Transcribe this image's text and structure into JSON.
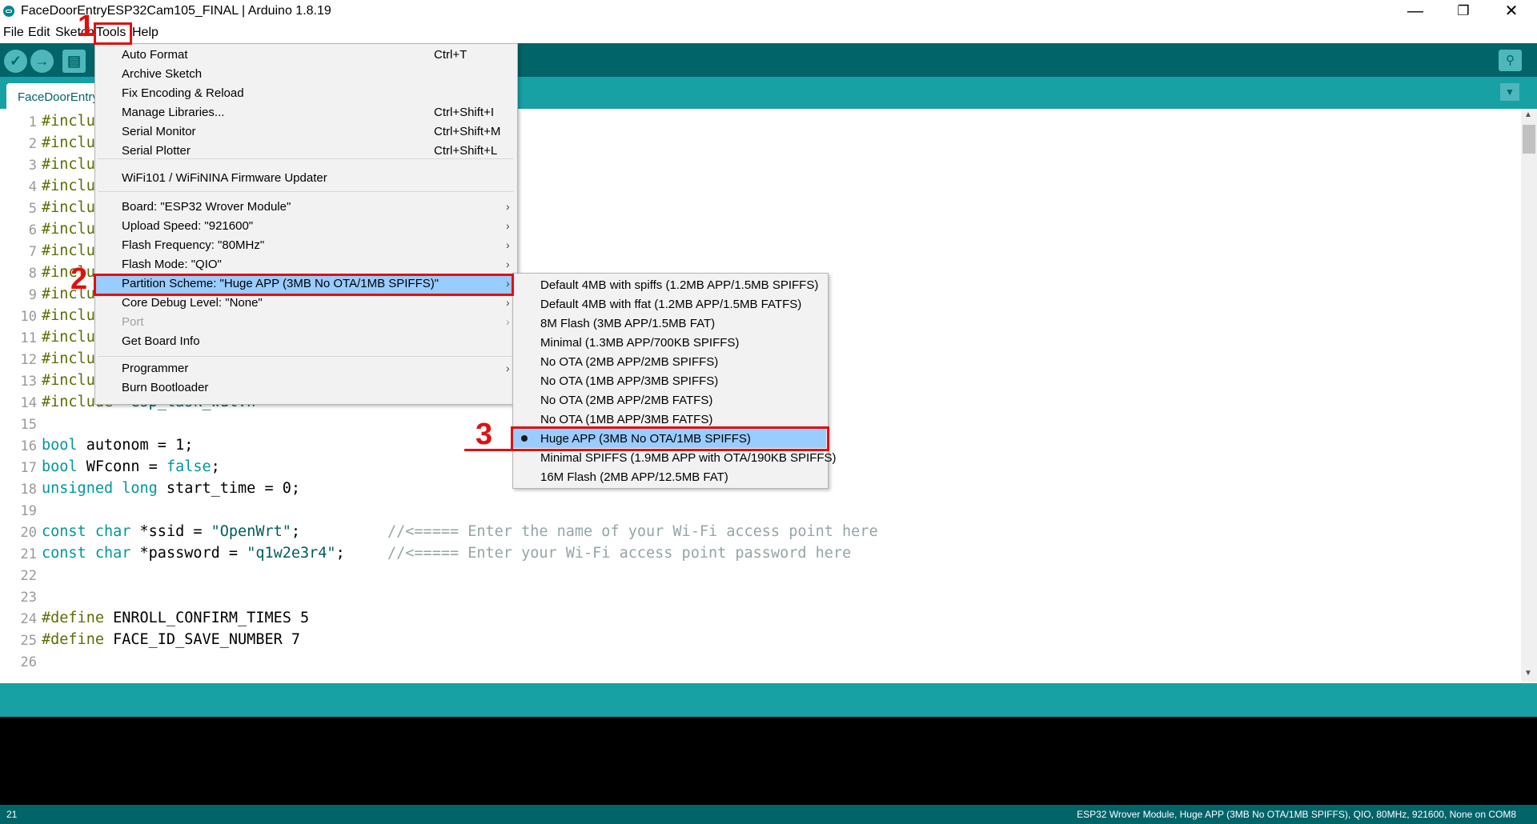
{
  "window": {
    "title": "FaceDoorEntryESP32Cam105_FINAL | Arduino 1.8.19",
    "minimize": "—",
    "maximize": "❐",
    "close": "✕"
  },
  "menubar": [
    "File",
    "Edit",
    "Sketch",
    "Tools",
    "Help"
  ],
  "tab": {
    "label": "FaceDoorEntry"
  },
  "tools_menu": {
    "items": [
      {
        "label": "Auto Format",
        "shortcut": "Ctrl+T"
      },
      {
        "label": "Archive Sketch",
        "shortcut": ""
      },
      {
        "label": "Fix Encoding & Reload",
        "shortcut": ""
      },
      {
        "label": "Manage Libraries...",
        "shortcut": "Ctrl+Shift+I"
      },
      {
        "label": "Serial Monitor",
        "shortcut": "Ctrl+Shift+M"
      },
      {
        "label": "Serial Plotter",
        "shortcut": "Ctrl+Shift+L"
      },
      {
        "label": "WiFi101 / WiFiNINA Firmware Updater",
        "shortcut": ""
      },
      {
        "label": "Board: \"ESP32 Wrover Module\"",
        "shortcut": ""
      },
      {
        "label": "Upload Speed: \"921600\"",
        "shortcut": ""
      },
      {
        "label": "Flash Frequency: \"80MHz\"",
        "shortcut": ""
      },
      {
        "label": "Flash Mode: \"QIO\"",
        "shortcut": ""
      },
      {
        "label": "Partition Scheme: \"Huge APP (3MB No OTA/1MB SPIFFS)\"",
        "shortcut": ""
      },
      {
        "label": "Core Debug Level: \"None\"",
        "shortcut": ""
      },
      {
        "label": "Port",
        "shortcut": ""
      },
      {
        "label": "Get Board Info",
        "shortcut": ""
      },
      {
        "label": "Programmer",
        "shortcut": ""
      },
      {
        "label": "Burn Bootloader",
        "shortcut": ""
      }
    ]
  },
  "partition_submenu": {
    "selected": "Huge APP (3MB No OTA/1MB SPIFFS)",
    "items": [
      "Default 4MB with spiffs (1.2MB APP/1.5MB SPIFFS)",
      "Default 4MB with ffat (1.2MB APP/1.5MB FATFS)",
      "8M Flash (3MB APP/1.5MB FAT)",
      "Minimal (1.3MB APP/700KB SPIFFS)",
      "No OTA (2MB APP/2MB SPIFFS)",
      "No OTA (1MB APP/3MB SPIFFS)",
      "No OTA (2MB APP/2MB FATFS)",
      "No OTA (1MB APP/3MB FATFS)",
      "Huge APP (3MB No OTA/1MB SPIFFS)",
      "Minimal SPIFFS (1.9MB APP with OTA/190KB SPIFFS)",
      "16M Flash (2MB APP/12.5MB FAT)"
    ]
  },
  "annotations": {
    "step1": "1",
    "step2": "2",
    "step3": "3"
  },
  "code": {
    "line_numbers": [
      "1",
      "2",
      "3",
      "4",
      "5",
      "6",
      "7",
      "8",
      "9",
      "10",
      "11",
      "12",
      "13",
      "14",
      "15",
      "16",
      "17",
      "18",
      "19",
      "20",
      "21",
      "22",
      "23",
      "24",
      "25",
      "26"
    ],
    "include_kw": "#inclu",
    "line14_kw": "#include",
    "line14_rest": "\"esp_task_wdt.h\"",
    "line16": {
      "type": "bool",
      "rest": " autonom = 1;"
    },
    "line17": {
      "type": "bool",
      "rest1": " WFconn = ",
      "val": "false",
      "rest2": ";"
    },
    "line18": {
      "type": "unsigned long",
      "rest": " start_time = 0;"
    },
    "line20": {
      "kw": "const char",
      "rest": " *ssid = ",
      "str": "\"OpenWrt\"",
      "end": ";",
      "comment": "//<===== Enter the name of your Wi-Fi access point here"
    },
    "line21": {
      "kw": "const char",
      "rest": " *password = ",
      "str": "\"q1w2e3r4\"",
      "end": ";",
      "comment": "//<===== Enter your Wi-Fi access point password here"
    },
    "line24": {
      "kw": "#define",
      "rest": " ENROLL_CONFIRM_TIMES 5"
    },
    "line25": {
      "kw": "#define",
      "rest": " FACE_ID_SAVE_NUMBER 7"
    }
  },
  "status": {
    "line": "21",
    "board": "ESP32 Wrover Module, Huge APP (3MB No OTA/1MB SPIFFS), QIO, 80MHz, 921600, None on COM8"
  },
  "colors": {
    "teal_dark": "#006468",
    "teal": "#17a1a5",
    "highlight": "#99ccff",
    "annotation": "#e01010"
  }
}
